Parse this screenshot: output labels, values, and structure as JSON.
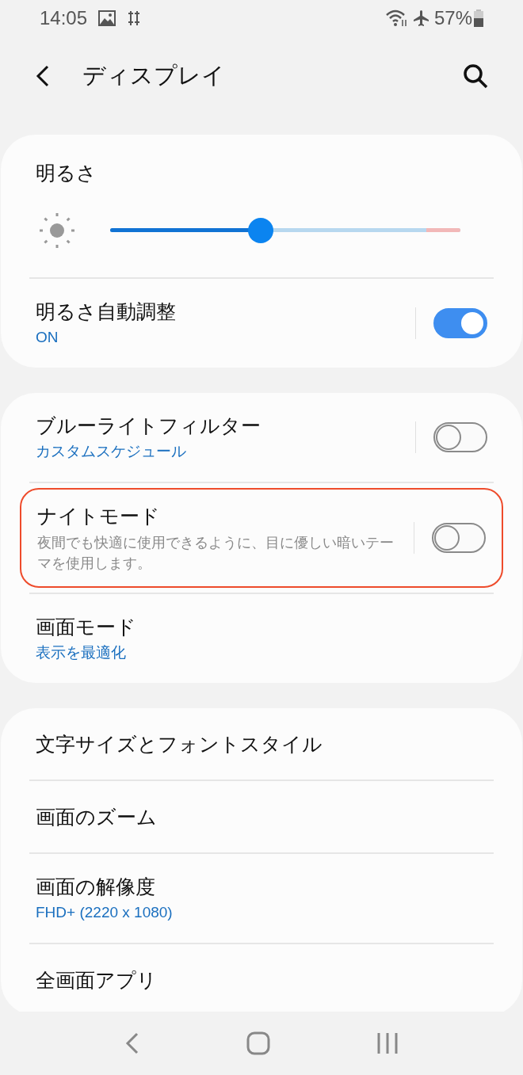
{
  "status_bar": {
    "time": "14:05",
    "battery": "57%"
  },
  "header": {
    "title": "ディスプレイ"
  },
  "cards": [
    {
      "items": [
        {
          "kind": "slider",
          "title": "明るさ",
          "level": 0.43
        },
        {
          "kind": "toggle",
          "title": "明るさ自動調整",
          "subtitle": "ON",
          "on": true,
          "highlighted": false
        }
      ]
    },
    {
      "items": [
        {
          "kind": "toggle",
          "title": "ブルーライトフィルター",
          "subtitle": "カスタムスケジュール",
          "on": false,
          "highlighted": false
        },
        {
          "kind": "toggle",
          "title": "ナイトモード",
          "description": "夜間でも快適に使用できるように、目に優しい暗いテーマを使用します。",
          "on": false,
          "highlighted": true
        },
        {
          "kind": "link",
          "title": "画面モード",
          "subtitle": "表示を最適化"
        }
      ]
    },
    {
      "items": [
        {
          "kind": "link",
          "title": "文字サイズとフォントスタイル"
        },
        {
          "kind": "link",
          "title": "画面のズーム"
        },
        {
          "kind": "link",
          "title": "画面の解像度",
          "subtitle": "FHD+ (2220 x 1080)"
        },
        {
          "kind": "link",
          "title": "全画面アプリ"
        }
      ]
    }
  ]
}
